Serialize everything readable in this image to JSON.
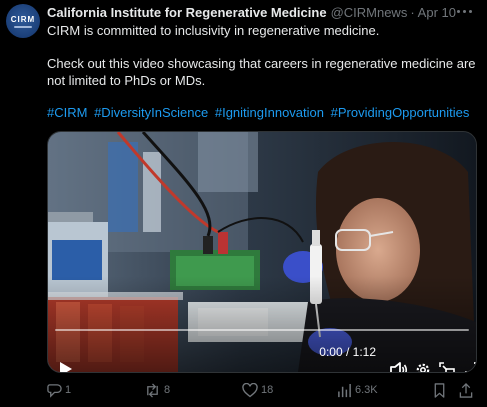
{
  "author": {
    "avatar_text": "CIRM",
    "name": "California Institute for Regenerative Medicine",
    "handle": "@CIRMnews",
    "separator": "·",
    "time": "Apr 10"
  },
  "post": {
    "line1": "CIRM is committed to inclusivity in regenerative medicine.",
    "line2": "Check out this video showcasing that careers in regenerative medicine are",
    "line3": "not limited to PhDs or MDs.",
    "hashtags": [
      "#CIRM",
      "#DiversityInScience",
      "#IgnitingInnovation",
      "#ProvidingOpportunities"
    ]
  },
  "video": {
    "current_time": "0:00",
    "duration": "1:12",
    "time_separator": " / ",
    "progress_fraction": 0.0
  },
  "actions": {
    "reply_count": "1",
    "repost_count": "8",
    "like_count": "18",
    "view_count": "6.3K"
  },
  "colors": {
    "link": "#1d9bf0",
    "secondary_text": "#71767b",
    "primary_text": "#e7e9ea",
    "avatar_bg": "#1b3f78"
  },
  "icons": {
    "more": "more-dots-icon",
    "play": "play-icon",
    "volume": "volume-icon",
    "settings": "gear-icon",
    "pip": "picture-in-picture-icon",
    "fullscreen": "fullscreen-icon",
    "reply": "reply-icon",
    "repost": "repost-icon",
    "like": "heart-icon",
    "views": "views-chart-icon",
    "bookmark": "bookmark-icon",
    "share": "share-icon"
  }
}
